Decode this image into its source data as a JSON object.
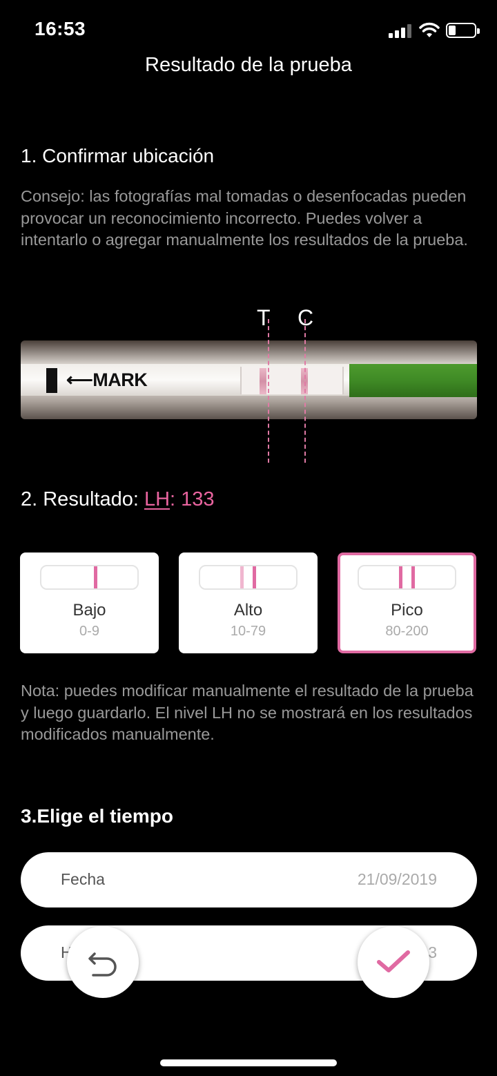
{
  "status_bar": {
    "time": "16:53"
  },
  "header": {
    "title": "Resultado de la prueba"
  },
  "step1": {
    "title": "1. Confirmar ubicación",
    "tip": "Consejo: las fotografías mal tomadas o desenfocadas pueden provocar un reconocimiento incorrecto. Puedes volver a intentarlo o agregar manualmente los resultados de la prueba.",
    "t_label": "T",
    "c_label": "C",
    "strip_text": "MARK"
  },
  "step2": {
    "prefix": "2. Resultado: ",
    "lh_label": "LH",
    "colon": ": ",
    "value": "133",
    "levels": [
      {
        "name": "Bajo",
        "range": "0-9",
        "selected": false
      },
      {
        "name": "Alto",
        "range": "10-79",
        "selected": false
      },
      {
        "name": "Pico",
        "range": "80-200",
        "selected": true
      }
    ],
    "note": "Nota: puedes modificar manualmente el resultado de la prueba y luego guardarlo. El nivel LH no se mostrará en los resultados modificados manualmente."
  },
  "step3": {
    "title": "3.Elige el tiempo",
    "date_label": "Fecha",
    "date_value": "21/09/2019",
    "hour_label_partial": "H",
    "hour_value_partial": "3"
  },
  "colors": {
    "accent": "#e06aa2",
    "background": "#000000"
  },
  "icons": {
    "back": "undo-arrow-icon",
    "confirm": "check-icon"
  }
}
